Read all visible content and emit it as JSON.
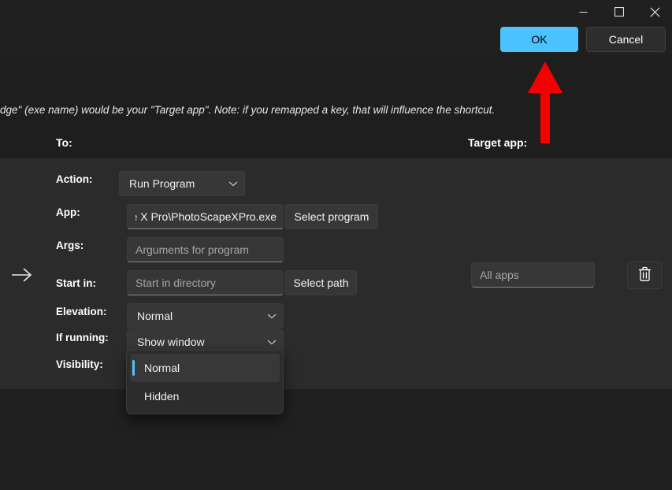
{
  "window": {
    "controls": {
      "minimize": "minimize-button",
      "maximize": "maximize-button",
      "close": "close-button"
    }
  },
  "dialog": {
    "ok_label": "OK",
    "cancel_label": "Cancel",
    "accent_color": "#4cc2ff"
  },
  "header": {
    "note": "dge\" (exe name) would be your \"Target app\". Note: if you remapped a key, that will influence the shortcut.",
    "to_heading": "To:",
    "target_app_heading": "Target app:"
  },
  "form": {
    "rows": [
      {
        "label": "Action:",
        "value": "Run Program"
      },
      {
        "label": "App:",
        "value": "oe X Pro\\PhotoScapeXPro.exe",
        "button": "Select program"
      },
      {
        "label": "Args:",
        "placeholder": "Arguments for program"
      },
      {
        "label": "Start in:",
        "placeholder": "Start in directory",
        "button": "Select path"
      },
      {
        "label": "Elevation:",
        "value": "Normal"
      },
      {
        "label": "If running:",
        "value": "Show window"
      },
      {
        "label": "Visibility:",
        "value": "Normal"
      }
    ]
  },
  "target_app": {
    "placeholder": "All apps"
  },
  "visibility_dropdown": {
    "open": true,
    "options": [
      {
        "label": "Normal",
        "selected": true
      },
      {
        "label": "Hidden",
        "selected": false
      }
    ]
  },
  "annotation": {
    "arrow_color": "#f40000",
    "points_to": "OK"
  }
}
